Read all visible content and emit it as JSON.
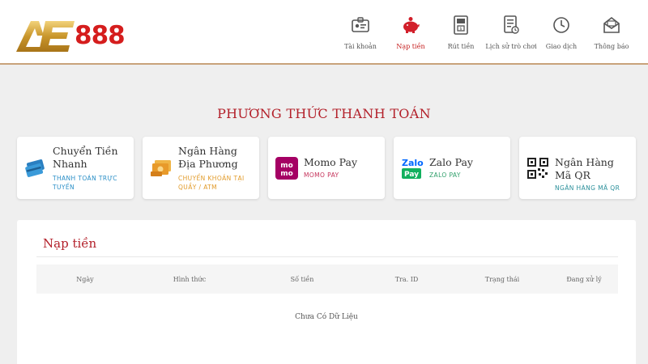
{
  "header": {
    "brand": {
      "logo_text": "AE",
      "number": "888"
    },
    "nav": [
      {
        "label": "Tài khoản",
        "icon": "account-card-icon",
        "active": false
      },
      {
        "label": "Nạp tiền",
        "icon": "piggy-bank-icon",
        "active": true
      },
      {
        "label": "Rút tiền",
        "icon": "withdraw-atm-icon",
        "active": false
      },
      {
        "label": "Lịch sử trò chơi",
        "icon": "game-history-icon",
        "active": false
      },
      {
        "label": "Giao dịch",
        "icon": "clock-icon",
        "active": false
      },
      {
        "label": "Thông báo",
        "icon": "envelope-icon",
        "active": false
      }
    ]
  },
  "payment": {
    "title": "PHƯƠNG THỨC THANH TOÁN",
    "methods": [
      {
        "name": "Chuyển Tiền Nhanh",
        "sub": "THANH TOÁN TRỰC TUYẾN",
        "icon": "fast-transfer-cards-icon"
      },
      {
        "name": "Ngân Hàng Địa Phương",
        "sub": "CHUYỂN KHOẢN TẠI QUẦY / ATM",
        "icon": "local-bank-cash-icon"
      },
      {
        "name": "Momo Pay",
        "sub": "MOMO PAY",
        "icon": "momo-logo-icon"
      },
      {
        "name": "Zalo Pay",
        "sub": "ZALO PAY",
        "icon": "zalopay-logo-icon"
      },
      {
        "name": "Ngân Hàng Mã QR",
        "sub": "NGÂN HÀNG MÃ QR",
        "icon": "qr-code-icon"
      }
    ]
  },
  "deposit": {
    "title": "Nạp tiền",
    "columns": [
      "Ngày",
      "Hình thức",
      "Số tiền",
      "Tra. ID",
      "Trạng thái",
      "Đang xử lý"
    ],
    "empty_text": "Chưa Có Dữ Liệu"
  },
  "colors": {
    "accent_red": "#b3202a",
    "brand_gold": "#c9962c",
    "header_border": "#c8a27a"
  }
}
